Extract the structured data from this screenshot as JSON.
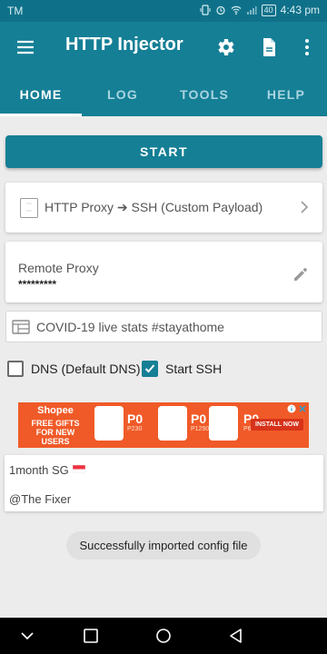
{
  "status_bar": {
    "carrier": "TM",
    "battery": "40",
    "time": "4:43 pm"
  },
  "app_bar": {
    "title": "HTTP Injector",
    "icons": [
      "menu-icon",
      "gear-icon",
      "file-icon",
      "more-vert-icon"
    ]
  },
  "tabs": [
    {
      "label": "HOME",
      "active": true
    },
    {
      "label": "LOG",
      "active": false
    },
    {
      "label": "TOOLS",
      "active": false
    },
    {
      "label": "HELP",
      "active": false
    }
  ],
  "start_button": {
    "label": "START"
  },
  "connection_mode": {
    "label": "HTTP Proxy ➔ SSH (Custom Payload)"
  },
  "remote_proxy": {
    "label": "Remote Proxy",
    "value": "*********"
  },
  "covid": {
    "label": "COVID-19 live stats #stayathome"
  },
  "options": {
    "dns": {
      "label": "DNS (Default DNS)",
      "checked": false
    },
    "ssh": {
      "label": "Start SSH",
      "checked": true
    }
  },
  "ad": {
    "brand": "Shopee",
    "tagline": "FREE GIFTS FOR NEW USERS",
    "prices": [
      {
        "now": "P0",
        "was": "P230"
      },
      {
        "now": "P0",
        "was": "P1290"
      },
      {
        "now": "P0",
        "was": "P65"
      }
    ],
    "cta": "INSTALL NOW"
  },
  "notes": {
    "line1": "1month SG",
    "line2": "@The Fixer"
  },
  "toast": {
    "text": "Successfully imported config file"
  },
  "colors": {
    "primary": "#157f96",
    "status_bar": "#0f7189",
    "background": "#ececec"
  }
}
